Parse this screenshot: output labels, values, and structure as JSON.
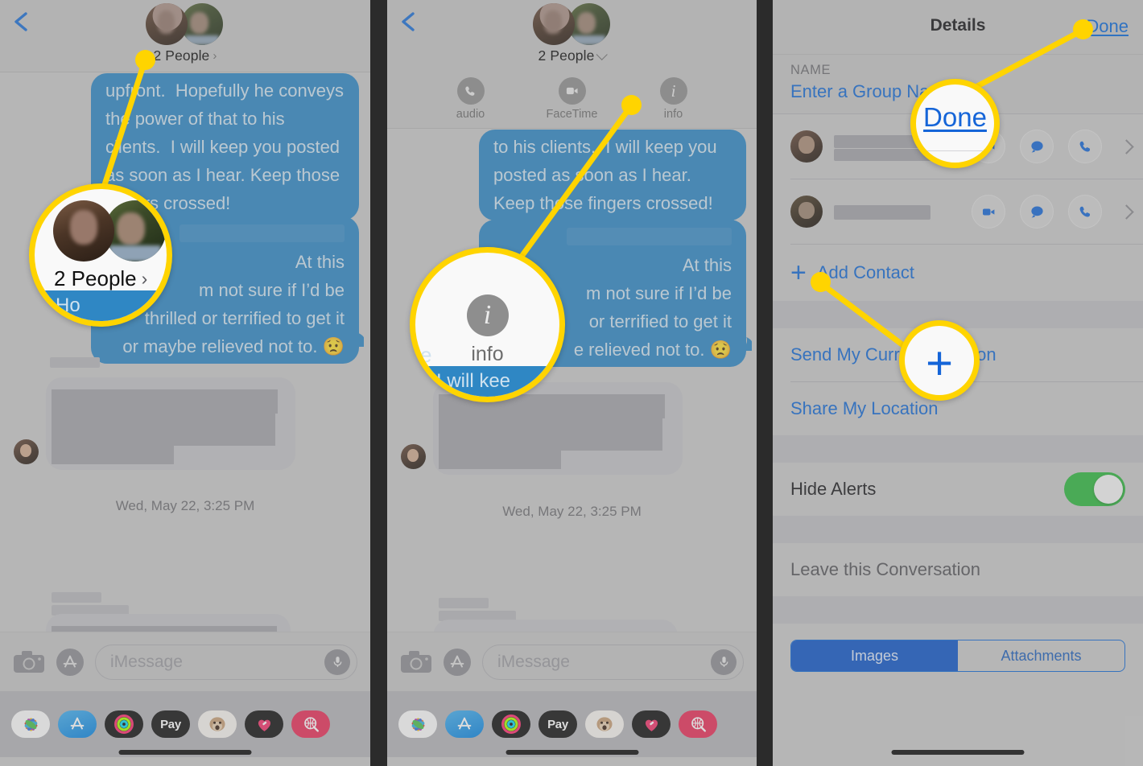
{
  "panels": [
    {
      "id": "messages-conversation",
      "nav": {
        "back": "‹",
        "group_label": "2 People",
        "chevron": "›"
      },
      "messages": [
        {
          "from": "me",
          "text": "upfront.  Hopefully he conveys the power of that to his clients.  I will keep you posted as soon as I hear.  Keep those fingers crossed!"
        },
        {
          "from": "me",
          "text": "At this  m not sure if I'd be thrilled or terrified to get it or maybe relieved not to. 😟"
        }
      ],
      "timestamp": "Wed, May 22, 3:25 PM",
      "composer": {
        "placeholder": "iMessage",
        "camera_icon": "camera-icon",
        "apps_icon": "app-store-icon",
        "mic_icon": "microphone-icon"
      },
      "app_drawer": [
        "photos-app-icon",
        "app-store-app-icon",
        "activity-rings-app-icon",
        "apple-pay-app-icon",
        "animoji-app-icon",
        "music-heart-app-icon",
        "images-search-app-icon"
      ]
    },
    {
      "id": "messages-conversation-quickactions",
      "nav": {
        "back": "‹",
        "group_label": "2 People"
      },
      "quick_actions": [
        {
          "icon": "phone-icon",
          "label": "audio"
        },
        {
          "icon": "video-camera-icon",
          "label": "FaceTime"
        },
        {
          "icon": "info-icon",
          "label": "info"
        }
      ],
      "messages": [
        {
          "from": "me",
          "text": "to his clients.  I will keep you posted as soon as I hear.  Keep those fingers crossed!"
        },
        {
          "from": "me",
          "text": "At this   not sure if I'd be   terrified to get it   relieved not to. 😟"
        }
      ],
      "timestamp": "Wed, May 22, 3:25 PM",
      "composer": {
        "placeholder": "iMessage"
      }
    },
    {
      "id": "details",
      "nav": {
        "title": "Details",
        "done": "Done"
      },
      "name_section": {
        "label": "NAME",
        "group_name_placeholder": "Enter a Group Name"
      },
      "contacts": [
        {
          "actions": [
            "video-camera-icon",
            "message-bubble-icon",
            "phone-icon"
          ],
          "chevron": "›"
        },
        {
          "actions": [
            "video-camera-icon",
            "message-bubble-icon",
            "phone-icon"
          ],
          "chevron": "›"
        }
      ],
      "add_contact": {
        "plus": "+",
        "label": "Add Contact"
      },
      "location_options": [
        "Send My Current Location",
        "Share My Location"
      ],
      "hide_alerts": {
        "label": "Hide Alerts",
        "enabled": true,
        "color": "#2fb83f"
      },
      "leave": "Leave this Conversation",
      "segmented": {
        "options": [
          "Images",
          "Attachments"
        ],
        "selected": "Images",
        "accent": "#1057c8"
      }
    }
  ],
  "callouts": [
    {
      "id": "two-people-callout",
      "magnified": {
        "label": "2 People",
        "chevron": "›",
        "strip_text": "Ho"
      }
    },
    {
      "id": "info-button-callout",
      "magnified": {
        "icon": "info-icon",
        "label": "info",
        "strip_text": "I will kee",
        "left_text": "e"
      }
    },
    {
      "id": "done-button-callout",
      "magnified": {
        "label": "Done"
      }
    },
    {
      "id": "add-contact-plus-callout",
      "magnified": {
        "label": "+"
      }
    }
  ],
  "theme": {
    "accent_blue": "#1369d4",
    "bubble_blue": "#2f87c4",
    "callout_yellow": "#ffd400",
    "toggle_green": "#2fb83f",
    "panel_bg": "#c9c9c9"
  }
}
